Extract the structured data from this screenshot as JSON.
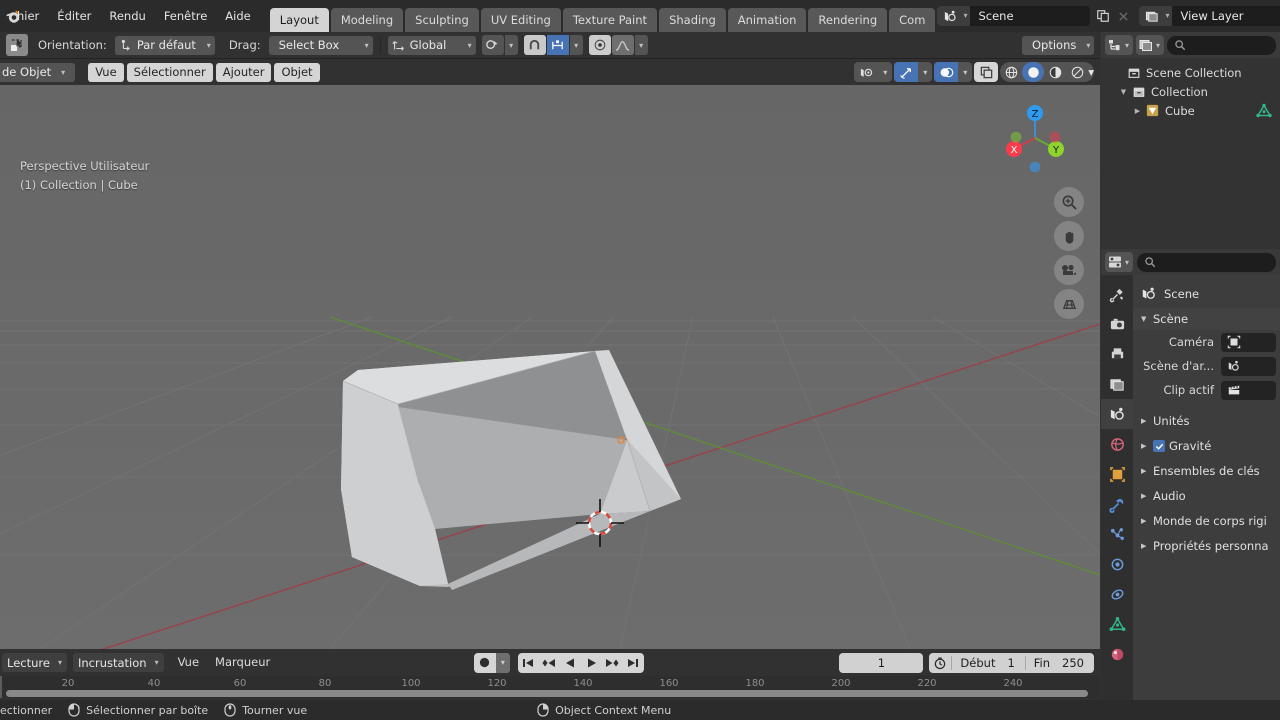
{
  "topbar": {
    "menus": [
      "hier",
      "Éditer",
      "Rendu",
      "Fenêtre",
      "Aide"
    ],
    "workspace_tabs": [
      {
        "label": "Layout",
        "active": true
      },
      {
        "label": "Modeling",
        "active": false
      },
      {
        "label": "Sculpting",
        "active": false
      },
      {
        "label": "UV Editing",
        "active": false
      },
      {
        "label": "Texture Paint",
        "active": false
      },
      {
        "label": "Shading",
        "active": false
      },
      {
        "label": "Animation",
        "active": false
      },
      {
        "label": "Rendering",
        "active": false
      },
      {
        "label": "Com",
        "active": false
      }
    ],
    "scene_name": "Scene",
    "view_layer_name": "View Layer",
    "scene_icon": "scene-icon",
    "viewlayer_icon": "render-layers-icon",
    "copy_icon": "duplicate-icon",
    "close_icon": "x-icon"
  },
  "toolsettings": {
    "active_tool_icon": "select-box-tool-icon",
    "orientation_label": "Orientation:",
    "orientation_value": "Par défaut",
    "drag_label": "Drag:",
    "drag_value": "Select Box",
    "transform_orientation": "Global",
    "snap_icon": "magnet-icon",
    "proportional_icon": "proportional-edit-icon",
    "snap_target_icon": "snap-increment-icon",
    "pivot_icon": "pivot-point-icon",
    "falloff_icon": "falloff-curve-icon",
    "options_label": "Options"
  },
  "viewport": {
    "mode": "de Objet",
    "menus": [
      "Vue",
      "Sélectionner",
      "Ajouter",
      "Objet"
    ],
    "overlay_line1": "Perspective Utilisateur",
    "overlay_line2": "(1) Collection | Cube",
    "background_color": "#666666",
    "header_icons": {
      "visibility": "eye-selectability-icon",
      "gizmo": "gizmo-icon",
      "overlays": "overlays-icon",
      "xray": "xray-toggle-icon"
    },
    "shading_modes": [
      {
        "name": "wireframe-shading-icon",
        "active": false
      },
      {
        "name": "solid-shading-icon",
        "active": true
      },
      {
        "name": "material-preview-shading-icon",
        "active": false
      },
      {
        "name": "rendered-shading-icon",
        "active": false
      }
    ],
    "gizmo_axes": [
      {
        "label": "X",
        "color": "#fa3c4d"
      },
      {
        "label": "Y",
        "color": "#8fd32b"
      },
      {
        "label": "Z",
        "color": "#2e9bf0"
      }
    ],
    "nav_buttons": [
      "zoom-icon",
      "pan-hand-icon",
      "camera-view-icon",
      "ortho-persp-toggle-icon"
    ],
    "object_name": "Cube"
  },
  "timeline": {
    "playback_label": "Lecture",
    "overlay_label": "Incrustation",
    "menus": [
      "Vue",
      "Marqueur"
    ],
    "record_icon": "record-keyframe-icon",
    "play_buttons": [
      "jump-to-start-icon",
      "jump-prev-keyframe-icon",
      "play-reverse-icon",
      "play-icon",
      "jump-next-keyframe-icon",
      "jump-to-end-icon"
    ],
    "current_frame": "1",
    "clock_icon": "use-preview-range-icon",
    "start_label": "Début",
    "start_value": "1",
    "end_label": "Fin",
    "end_value": "250",
    "ruler_ticks": [
      "20",
      "40",
      "60",
      "80",
      "100",
      "120",
      "140",
      "160",
      "180",
      "200",
      "220",
      "240"
    ]
  },
  "outliner": {
    "display_mode_icon": "outliner-display-mode-icon",
    "filter_icon": "filter-icon",
    "search_icon": "search-icon",
    "search_placeholder": "",
    "rows": [
      {
        "label": "Scene Collection",
        "icon": "scene-collection-icon",
        "depth": 0,
        "disclosure": "",
        "right_icon": ""
      },
      {
        "label": "Collection",
        "icon": "collection-icon",
        "depth": 1,
        "disclosure": "▼",
        "right_icon": ""
      },
      {
        "label": "Cube",
        "icon": "mesh-object-icon",
        "depth": 2,
        "disclosure": "▶",
        "right_icon": "mesh-data-icon"
      }
    ]
  },
  "properties": {
    "editor_icon": "properties-editor-icon",
    "search_icon": "search-icon",
    "tabs": [
      {
        "name": "tool-tab-icon",
        "active": false
      },
      {
        "name": "render-tab-icon",
        "active": false
      },
      {
        "name": "output-tab-icon",
        "active": false
      },
      {
        "name": "view-layer-tab-icon",
        "active": false
      },
      {
        "name": "scene-tab-icon",
        "active": true
      },
      {
        "name": "world-tab-icon",
        "active": false
      },
      {
        "name": "object-tab-icon",
        "active": false
      },
      {
        "name": "modifier-tab-icon",
        "active": false
      },
      {
        "name": "particles-tab-icon",
        "active": false
      },
      {
        "name": "physics-tab-icon",
        "active": false
      },
      {
        "name": "constraints-tab-icon",
        "active": false
      },
      {
        "name": "object-data-tab-icon",
        "active": false
      },
      {
        "name": "material-tab-icon",
        "active": false
      }
    ],
    "breadcrumb": "Scene",
    "breadcrumb_icon": "scene-icon",
    "panel_scene": {
      "title": "Scène",
      "rows": [
        {
          "label": "Caméra",
          "icon": "camera-data-icon",
          "value": ""
        },
        {
          "label": "Scène d'ar...",
          "icon": "scene-icon",
          "value": ""
        },
        {
          "label": "Clip actif",
          "icon": "movie-clip-icon",
          "value": ""
        }
      ]
    },
    "collapsed_panels": [
      {
        "label": "Unités",
        "checkbox": null
      },
      {
        "label": "Gravité",
        "checkbox": true
      },
      {
        "label": "Ensembles de clés",
        "checkbox": null
      },
      {
        "label": "Audio",
        "checkbox": null
      },
      {
        "label": "Monde de corps rigi",
        "checkbox": null
      },
      {
        "label": "Propriétés personna",
        "checkbox": null
      }
    ]
  },
  "statusbar": {
    "items": [
      {
        "icon": "mouse-left-icon",
        "text": "ectionner"
      },
      {
        "icon": "mouse-middle-drag-icon",
        "text": "Sélectionner par boîte"
      },
      {
        "icon": "mouse-middle-icon",
        "text": "Tourner vue"
      },
      {
        "icon": "mouse-right-icon",
        "text": "Object Context Menu"
      }
    ]
  },
  "colors": {
    "accent_blue": "#4772b3",
    "viewport_bg": "#666666",
    "header_bg": "#313131",
    "panel_bg": "#3d3d3d",
    "axis_x": "#9c3c42",
    "axis_y": "#6a9c3c",
    "object_fill": "#c4c6c8"
  }
}
